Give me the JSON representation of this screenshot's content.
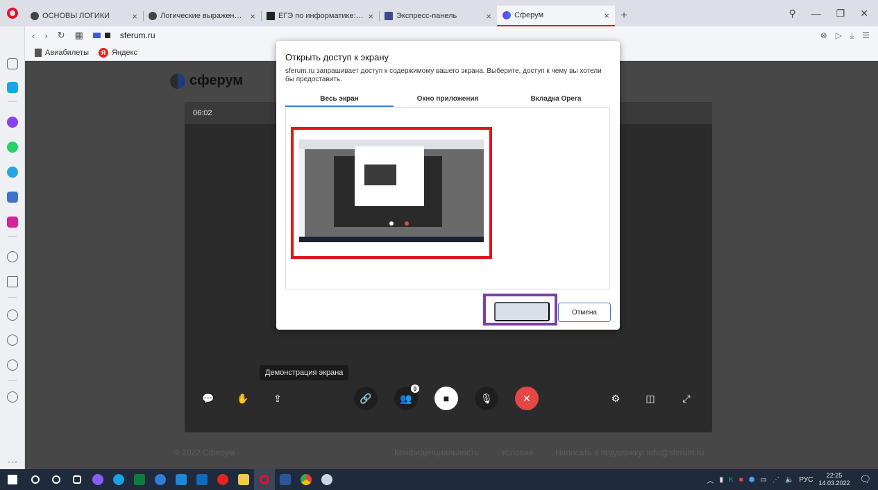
{
  "browser": {
    "tabs": [
      {
        "label": "ОСНОВЫ ЛОГИКИ",
        "favicon": "opera-gx-icon",
        "active": false
      },
      {
        "label": "Логические выражения, п",
        "favicon": "opera-gx-icon",
        "active": false
      },
      {
        "label": "ЕГЭ по информатике: под",
        "favicon": "k-icon",
        "active": false
      },
      {
        "label": "Экспресс-панель",
        "favicon": "grid-icon",
        "active": false
      },
      {
        "label": "Сферум",
        "favicon": "sferum-icon",
        "active": true
      }
    ],
    "url": "sferum.ru",
    "bookmarks": [
      "Авиабилеты",
      "Яндекс"
    ]
  },
  "page": {
    "logo_text": "сферум",
    "timer": "06:02",
    "tooltip": "Демонстрация экрана",
    "participants_badge": "0",
    "footer": {
      "copyright": "© 2022 Сферум",
      "privacy": "Конфиденциальность",
      "terms": "Условия",
      "support": "Написать в поддержку: info@sferum.ru"
    }
  },
  "modal": {
    "title": "Открыть доступ к экрану",
    "description": "sferum.ru запрашивает доступ к содержимому вашего экрана. Выберите, доступ к чему вы хотели бы предоставить.",
    "tabs": [
      "Весь экран",
      "Окно приложения",
      "Вкладка Opera"
    ],
    "active_tab": "Весь экран",
    "share_label": "",
    "cancel_label": "Отмена"
  },
  "taskbar": {
    "language": "РУС",
    "time": "22:25",
    "date": "14.03.2022"
  },
  "colors": {
    "accent": "#3b7bd6",
    "highlight_red": "#e3151a",
    "highlight_purple": "#7c3fa8",
    "end_call": "#e64646"
  }
}
